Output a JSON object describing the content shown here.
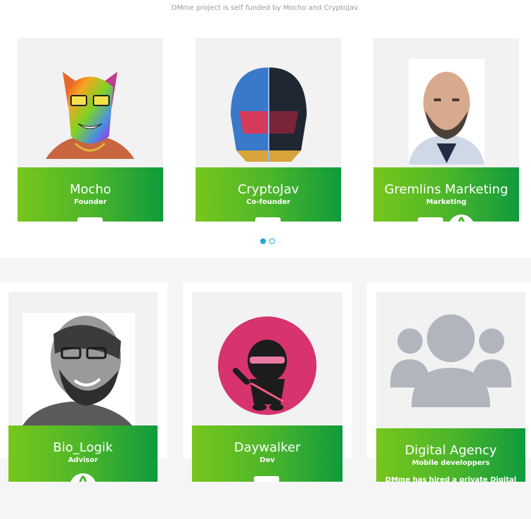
{
  "intro_text": "DMme project is self funded by Mocho and CryptoJav.",
  "carousel": {
    "active_index": 0,
    "slide_count": 2,
    "accent_color": "#1aa9d6",
    "members": [
      {
        "name": "Mocho",
        "role": "Founder",
        "photo": "colorful-wolf-avatar"
      },
      {
        "name": "CryptoJav",
        "role": "Co-founder",
        "photo": "robot-helmet-avatar"
      },
      {
        "name": "Gremlins Marketing",
        "role": "Marketing",
        "photo": "bald-bearded-man-photo"
      }
    ]
  },
  "team_grid": {
    "members": [
      {
        "name": "Bio_Logik",
        "role": "Advisor",
        "photo": "bearded-man-glasses-photo"
      },
      {
        "name": "Daywalker",
        "role": "Dev",
        "photo": "ninja-avatar-pink-circle"
      },
      {
        "name": "Digital Agency",
        "role": "Mobile developpers",
        "description": "DMme has hired a private Digital",
        "photo": "group-icon"
      }
    ]
  },
  "colors": {
    "gradient_start": "#77c61c",
    "gradient_end": "#0f9b3c",
    "page_background": "#f5f5f5",
    "placeholder_icon": "#b1b6be"
  }
}
